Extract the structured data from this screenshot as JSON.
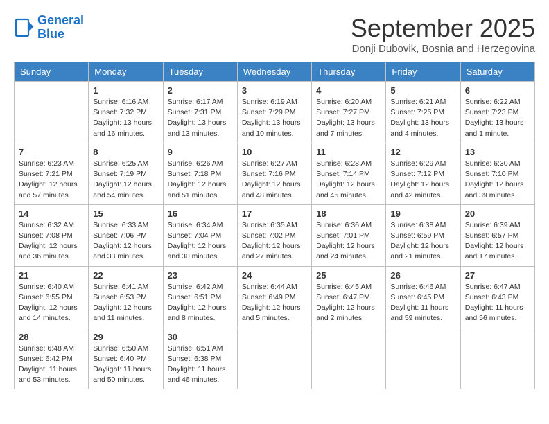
{
  "logo": {
    "line1": "General",
    "line2": "Blue"
  },
  "title": "September 2025",
  "subtitle": "Donji Dubovik, Bosnia and Herzegovina",
  "days_header": [
    "Sunday",
    "Monday",
    "Tuesday",
    "Wednesday",
    "Thursday",
    "Friday",
    "Saturday"
  ],
  "weeks": [
    [
      {
        "day": "",
        "info": ""
      },
      {
        "day": "1",
        "info": "Sunrise: 6:16 AM\nSunset: 7:32 PM\nDaylight: 13 hours\nand 16 minutes."
      },
      {
        "day": "2",
        "info": "Sunrise: 6:17 AM\nSunset: 7:31 PM\nDaylight: 13 hours\nand 13 minutes."
      },
      {
        "day": "3",
        "info": "Sunrise: 6:19 AM\nSunset: 7:29 PM\nDaylight: 13 hours\nand 10 minutes."
      },
      {
        "day": "4",
        "info": "Sunrise: 6:20 AM\nSunset: 7:27 PM\nDaylight: 13 hours\nand 7 minutes."
      },
      {
        "day": "5",
        "info": "Sunrise: 6:21 AM\nSunset: 7:25 PM\nDaylight: 13 hours\nand 4 minutes."
      },
      {
        "day": "6",
        "info": "Sunrise: 6:22 AM\nSunset: 7:23 PM\nDaylight: 13 hours\nand 1 minute."
      }
    ],
    [
      {
        "day": "7",
        "info": "Sunrise: 6:23 AM\nSunset: 7:21 PM\nDaylight: 12 hours\nand 57 minutes."
      },
      {
        "day": "8",
        "info": "Sunrise: 6:25 AM\nSunset: 7:19 PM\nDaylight: 12 hours\nand 54 minutes."
      },
      {
        "day": "9",
        "info": "Sunrise: 6:26 AM\nSunset: 7:18 PM\nDaylight: 12 hours\nand 51 minutes."
      },
      {
        "day": "10",
        "info": "Sunrise: 6:27 AM\nSunset: 7:16 PM\nDaylight: 12 hours\nand 48 minutes."
      },
      {
        "day": "11",
        "info": "Sunrise: 6:28 AM\nSunset: 7:14 PM\nDaylight: 12 hours\nand 45 minutes."
      },
      {
        "day": "12",
        "info": "Sunrise: 6:29 AM\nSunset: 7:12 PM\nDaylight: 12 hours\nand 42 minutes."
      },
      {
        "day": "13",
        "info": "Sunrise: 6:30 AM\nSunset: 7:10 PM\nDaylight: 12 hours\nand 39 minutes."
      }
    ],
    [
      {
        "day": "14",
        "info": "Sunrise: 6:32 AM\nSunset: 7:08 PM\nDaylight: 12 hours\nand 36 minutes."
      },
      {
        "day": "15",
        "info": "Sunrise: 6:33 AM\nSunset: 7:06 PM\nDaylight: 12 hours\nand 33 minutes."
      },
      {
        "day": "16",
        "info": "Sunrise: 6:34 AM\nSunset: 7:04 PM\nDaylight: 12 hours\nand 30 minutes."
      },
      {
        "day": "17",
        "info": "Sunrise: 6:35 AM\nSunset: 7:02 PM\nDaylight: 12 hours\nand 27 minutes."
      },
      {
        "day": "18",
        "info": "Sunrise: 6:36 AM\nSunset: 7:01 PM\nDaylight: 12 hours\nand 24 minutes."
      },
      {
        "day": "19",
        "info": "Sunrise: 6:38 AM\nSunset: 6:59 PM\nDaylight: 12 hours\nand 21 minutes."
      },
      {
        "day": "20",
        "info": "Sunrise: 6:39 AM\nSunset: 6:57 PM\nDaylight: 12 hours\nand 17 minutes."
      }
    ],
    [
      {
        "day": "21",
        "info": "Sunrise: 6:40 AM\nSunset: 6:55 PM\nDaylight: 12 hours\nand 14 minutes."
      },
      {
        "day": "22",
        "info": "Sunrise: 6:41 AM\nSunset: 6:53 PM\nDaylight: 12 hours\nand 11 minutes."
      },
      {
        "day": "23",
        "info": "Sunrise: 6:42 AM\nSunset: 6:51 PM\nDaylight: 12 hours\nand 8 minutes."
      },
      {
        "day": "24",
        "info": "Sunrise: 6:44 AM\nSunset: 6:49 PM\nDaylight: 12 hours\nand 5 minutes."
      },
      {
        "day": "25",
        "info": "Sunrise: 6:45 AM\nSunset: 6:47 PM\nDaylight: 12 hours\nand 2 minutes."
      },
      {
        "day": "26",
        "info": "Sunrise: 6:46 AM\nSunset: 6:45 PM\nDaylight: 11 hours\nand 59 minutes."
      },
      {
        "day": "27",
        "info": "Sunrise: 6:47 AM\nSunset: 6:43 PM\nDaylight: 11 hours\nand 56 minutes."
      }
    ],
    [
      {
        "day": "28",
        "info": "Sunrise: 6:48 AM\nSunset: 6:42 PM\nDaylight: 11 hours\nand 53 minutes."
      },
      {
        "day": "29",
        "info": "Sunrise: 6:50 AM\nSunset: 6:40 PM\nDaylight: 11 hours\nand 50 minutes."
      },
      {
        "day": "30",
        "info": "Sunrise: 6:51 AM\nSunset: 6:38 PM\nDaylight: 11 hours\nand 46 minutes."
      },
      {
        "day": "",
        "info": ""
      },
      {
        "day": "",
        "info": ""
      },
      {
        "day": "",
        "info": ""
      },
      {
        "day": "",
        "info": ""
      }
    ]
  ]
}
